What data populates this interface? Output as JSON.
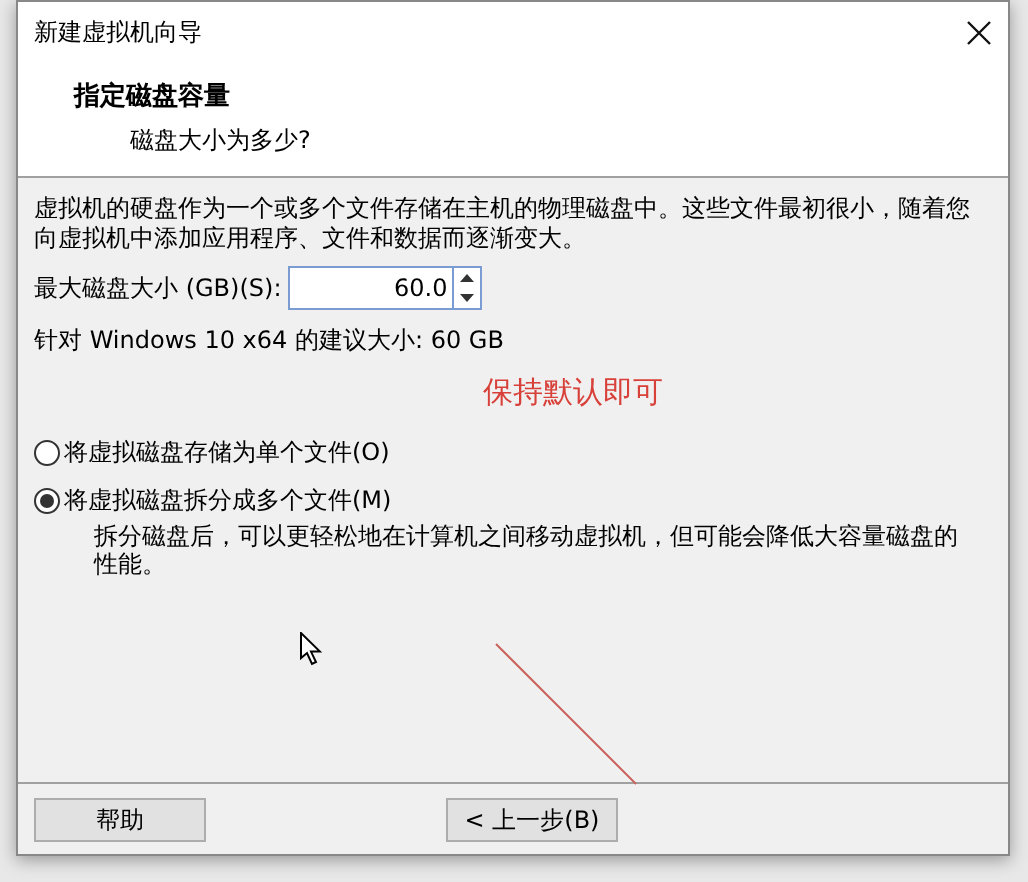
{
  "window": {
    "title": "新建虚拟机向导"
  },
  "header": {
    "title": "指定磁盘容量",
    "subtitle": "磁盘大小为多少?"
  },
  "description": "虚拟机的硬盘作为一个或多个文件存储在主机的物理磁盘中。这些文件最初很小，随着您向虚拟机中添加应用程序、文件和数据而逐渐变大。",
  "disk_size": {
    "label": "最大磁盘大小 (GB)(S):",
    "value": "60.0"
  },
  "recommendation": "针对 Windows 10 x64 的建议大小: 60 GB",
  "annotation": "保持默认即可",
  "options": [
    {
      "label": "将虚拟磁盘存储为单个文件(O)",
      "selected": false
    },
    {
      "label": "将虚拟磁盘拆分成多个文件(M)",
      "selected": true,
      "note": "拆分磁盘后，可以更轻松地在计算机之间移动虚拟机，但可能会降低大容量磁盘的性能。"
    }
  ],
  "buttons": [
    "帮助",
    "< 上一步(B)"
  ]
}
